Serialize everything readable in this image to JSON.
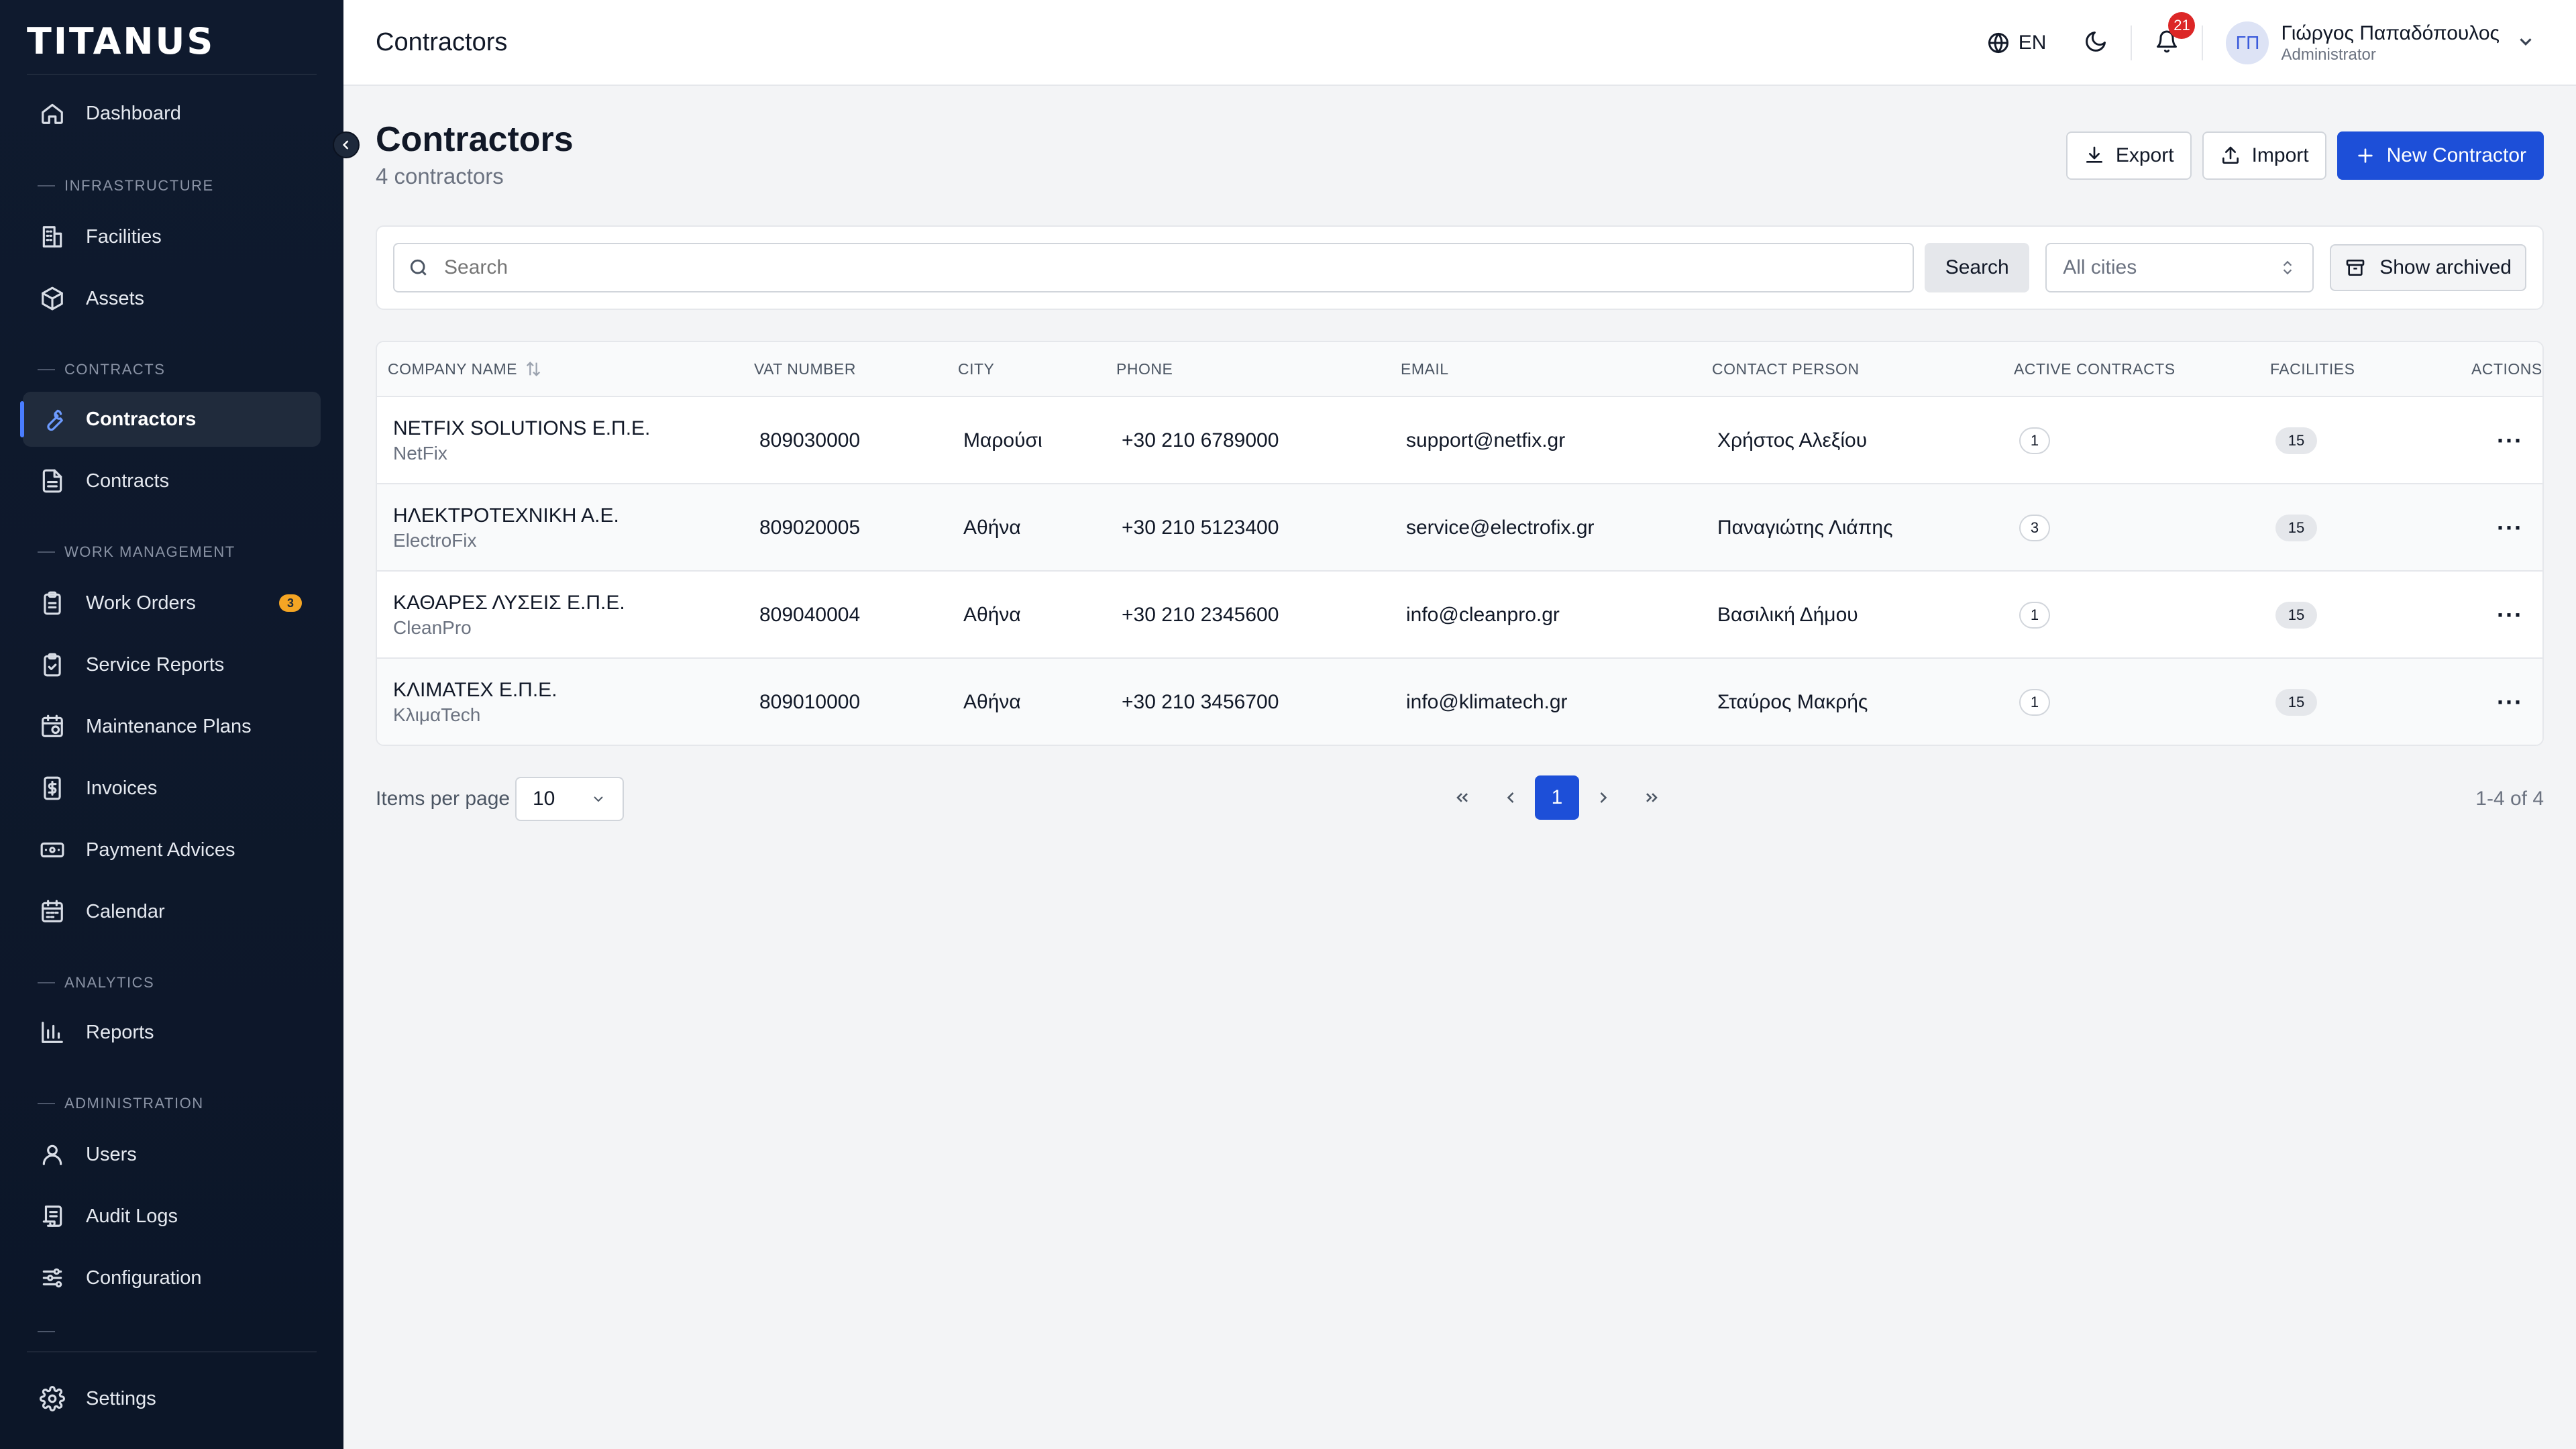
{
  "brand": "TITANUS",
  "sidebar": {
    "items": [
      {
        "label": "Dashboard"
      },
      {
        "label": "Facilities"
      },
      {
        "label": "Assets"
      },
      {
        "label": "Contractors"
      },
      {
        "label": "Contracts"
      },
      {
        "label": "Work Orders",
        "badge": "3"
      },
      {
        "label": "Service Reports"
      },
      {
        "label": "Maintenance Plans"
      },
      {
        "label": "Invoices"
      },
      {
        "label": "Payment Advices"
      },
      {
        "label": "Calendar"
      },
      {
        "label": "Reports"
      },
      {
        "label": "Users"
      },
      {
        "label": "Audit Logs"
      },
      {
        "label": "Configuration"
      },
      {
        "label": "Settings"
      }
    ],
    "sections": [
      "INFRASTRUCTURE",
      "CONTRACTS",
      "WORK MANAGEMENT",
      "ANALYTICS",
      "ADMINISTRATION"
    ],
    "active": "Contractors"
  },
  "topbar": {
    "title": "Contractors",
    "language": "EN",
    "notifications": "21",
    "user_initials": "ΓΠ",
    "user_name": "Γιώργος Παπαδόπουλος",
    "user_role": "Administrator"
  },
  "page": {
    "title": "Contractors",
    "subtitle": "4 contractors",
    "export_label": "Export",
    "import_label": "Import",
    "new_label": "New Contractor"
  },
  "filters": {
    "search_placeholder": "Search",
    "search_button": "Search",
    "city_select": "All cities",
    "show_archived": "Show archived"
  },
  "table": {
    "headers": [
      "COMPANY NAME",
      "VAT NUMBER",
      "CITY",
      "PHONE",
      "EMAIL",
      "CONTACT PERSON",
      "ACTIVE CONTRACTS",
      "FACILITIES",
      "ACTIONS"
    ],
    "rows": [
      {
        "company": "NETFIX SOLUTIONS Ε.Π.Ε.",
        "short": "NetFix",
        "vat": "809030000",
        "city": "Μαρούσι",
        "phone": "+30 210 6789000",
        "email": "support@netfix.gr",
        "contact": "Χρήστος Αλεξίου",
        "active": "1",
        "facilities": "15",
        "actions": "···"
      },
      {
        "company": "ΗΛΕΚΤΡΟΤΕΧΝΙΚΗ Α.Ε.",
        "short": "ElectroFix",
        "vat": "809020005",
        "city": "Αθήνα",
        "phone": "+30 210 5123400",
        "email": "service@electrofix.gr",
        "contact": "Παναγιώτης Λιάπης",
        "active": "3",
        "facilities": "15",
        "actions": "···"
      },
      {
        "company": "ΚΑΘΑΡΕΣ ΛΥΣΕΙΣ Ε.Π.Ε.",
        "short": "CleanPro",
        "vat": "809040004",
        "city": "Αθήνα",
        "phone": "+30 210 2345600",
        "email": "info@cleanpro.gr",
        "contact": "Βασιλική Δήμου",
        "active": "1",
        "facilities": "15",
        "actions": "···"
      },
      {
        "company": "ΚΛΙΜΑΤΕΧ Ε.Π.Ε.",
        "short": "ΚλιμαTech",
        "vat": "809010000",
        "city": "Αθήνα",
        "phone": "+30 210 3456700",
        "email": "info@klimatech.gr",
        "contact": "Σταύρος Μακρής",
        "active": "1",
        "facilities": "15",
        "actions": "···"
      }
    ]
  },
  "pagination": {
    "items_per_page_label": "Items per page",
    "items_per_page": "10",
    "current_page": "1",
    "range": "1-4 of 4"
  }
}
